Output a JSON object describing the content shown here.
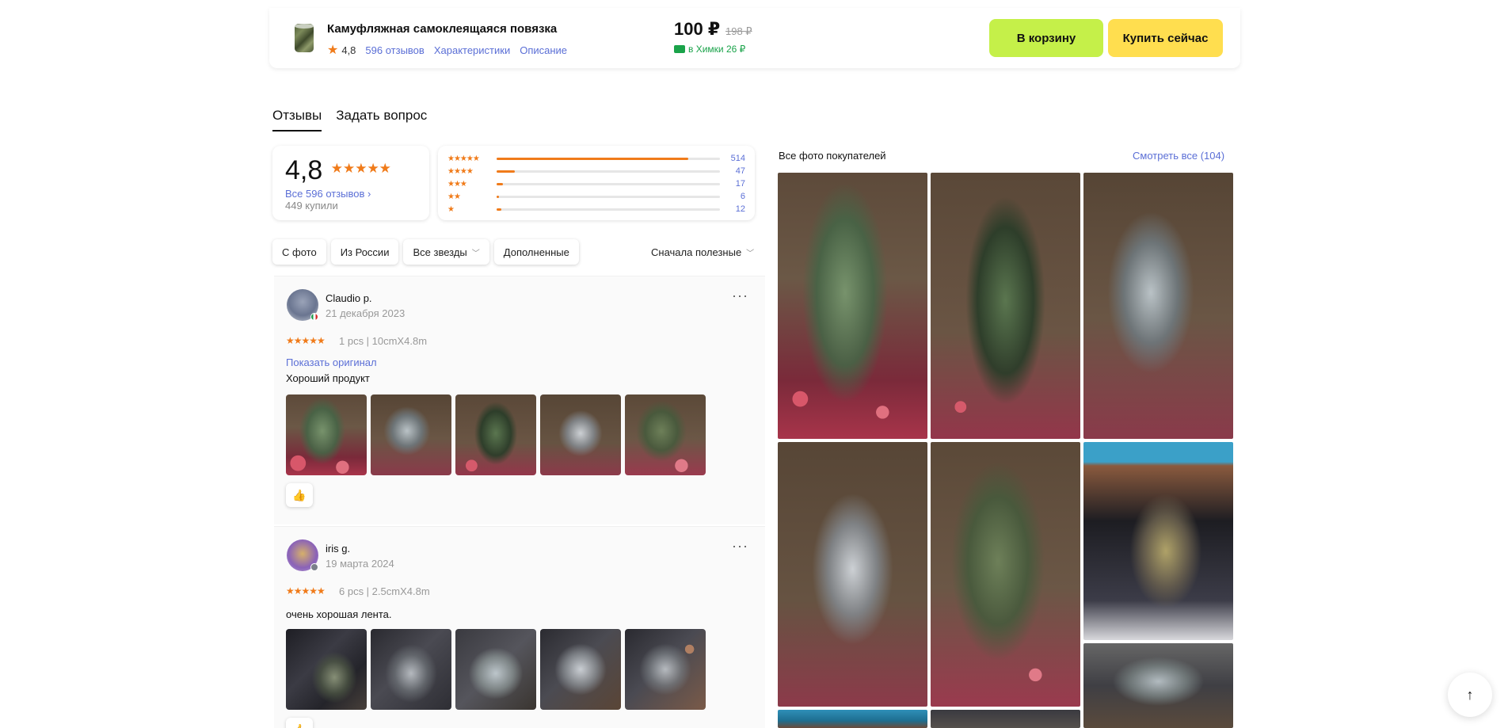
{
  "topbar": {
    "title": "Камуфляжная самоклеящаяся повязка",
    "rating": "4,8",
    "reviews_link": "596 отзывов",
    "specs_link": "Характеристики",
    "description_link": "Описание",
    "price": "100 ₽",
    "old_price": "198 ₽",
    "delivery": "в Химки 26 ₽",
    "cart_button": "В корзину",
    "buy_button": "Купить сейчас"
  },
  "tabs": [
    {
      "label": "Отзывы",
      "active": true
    },
    {
      "label": "Задать вопрос",
      "active": false
    }
  ],
  "summary": {
    "rating": "4,8",
    "stars": "★★★★★",
    "all_reviews": "Все 596 отзывов ›",
    "bought": "449 купили"
  },
  "distribution": [
    {
      "stars": "★★★★★",
      "fraction": 0.86,
      "count": "514"
    },
    {
      "stars": "★★★★",
      "fraction": 0.08,
      "count": "47"
    },
    {
      "stars": "★★★",
      "fraction": 0.03,
      "count": "17"
    },
    {
      "stars": "★★",
      "fraction": 0.01,
      "count": "6"
    },
    {
      "stars": "★",
      "fraction": 0.02,
      "count": "12"
    }
  ],
  "filters": {
    "with_photo": "С фото",
    "from_russia": "Из России",
    "all_stars": "Все звезды",
    "supplemented": "Дополненные",
    "sort": "Сначала полезные"
  },
  "reviews": [
    {
      "user": "Claudio p.",
      "date": "21 декабря 2023",
      "stars": "★★★★★",
      "variant": "1 pcs | 10cmX4.8m",
      "show_original": "Показать оригинал",
      "text": "Хороший продукт"
    },
    {
      "user": "iris g.",
      "date": "19 марта 2024",
      "stars": "★★★★★",
      "variant": "6 pcs | 2.5cmX4.8m",
      "text": "очень хорошая лента."
    }
  ],
  "gallery": {
    "title": "Все фото покупателей",
    "see_all": "Смотреть все (104)"
  },
  "icons": {
    "star": "star-icon",
    "more": "more-icon",
    "like": "thumbs-up-icon",
    "chevron": "chevron-down-icon",
    "arrow_up": "arrow-up-icon"
  },
  "colors": {
    "accent_orange": "#f07b1a",
    "link_blue": "#5b6fd6",
    "cart_green": "#c5f049",
    "buy_yellow": "#ffde4f",
    "delivery_green": "#1aa34a"
  }
}
